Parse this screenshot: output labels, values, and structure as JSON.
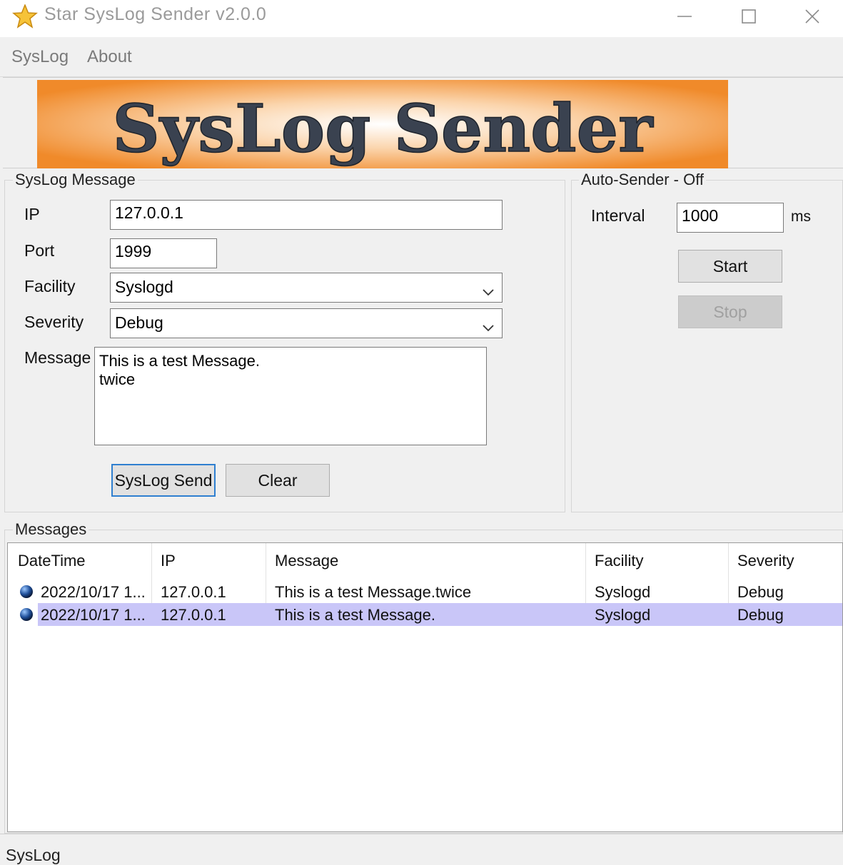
{
  "window": {
    "title": "Star SysLog Sender v2.0.0",
    "app_icon": "star-icon",
    "controls": [
      "minimize-icon",
      "maximize-icon",
      "close-icon"
    ]
  },
  "menu": {
    "items": [
      "SysLog",
      "About"
    ]
  },
  "banner": {
    "text": "SysLog Sender",
    "colors": {
      "center": "#ffffff",
      "edge": "#f08a2a",
      "text": "#3a4250"
    }
  },
  "syslog_message": {
    "title": "SysLog Message",
    "ip": {
      "label": "IP",
      "value": "127.0.0.1"
    },
    "port": {
      "label": "Port",
      "value": "1999"
    },
    "facility": {
      "label": "Facility",
      "value": "Syslogd"
    },
    "severity": {
      "label": "Severity",
      "value": "Debug"
    },
    "message": {
      "label": "Message",
      "value": "This is a test Message.\ntwice"
    },
    "send_label": "SysLog Send",
    "clear_label": "Clear"
  },
  "auto_sender": {
    "title": "Auto-Sender - Off",
    "interval": {
      "label": "Interval",
      "value": "1000",
      "unit": "ms"
    },
    "start_label": "Start",
    "stop_label": "Stop"
  },
  "messages": {
    "title": "Messages",
    "columns": [
      "DateTime",
      "IP",
      "Message",
      "Facility",
      "Severity"
    ],
    "rows": [
      {
        "datetime": "2022/10/17 1...",
        "ip": "127.0.0.1",
        "message": "This is a test Message.twice",
        "facility": "Syslogd",
        "severity": "Debug",
        "selected": false
      },
      {
        "datetime": "2022/10/17 1...",
        "ip": "127.0.0.1",
        "message": "This is a test Message.",
        "facility": "Syslogd",
        "severity": "Debug",
        "selected": true
      }
    ],
    "selection_color": "#c9c6f8"
  },
  "status": {
    "text": "SysLog"
  }
}
